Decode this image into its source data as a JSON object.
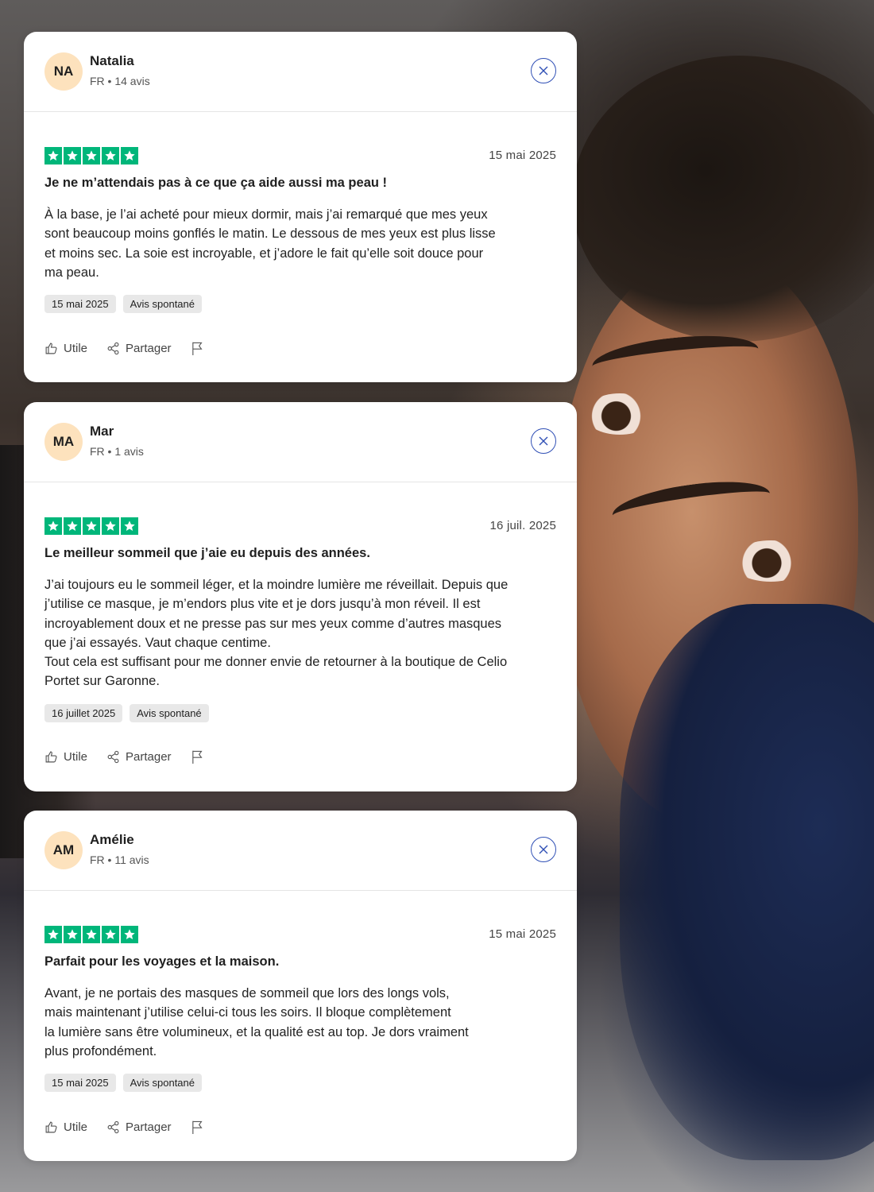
{
  "colors": {
    "star_green": "#00b67a",
    "avatar_bg": "#fde2bd",
    "close_blue": "#2f4fb5"
  },
  "reviews": [
    {
      "avatar_initials": "NA",
      "name": "Natalia",
      "meta": "FR • 14 avis",
      "rating": 5,
      "date": "15 mai 2025",
      "title": "Je ne m’attendais pas à ce que ça aide aussi ma peau !",
      "text": "À la base, je l’ai acheté pour mieux dormir, mais j’ai remarqué que mes yeux\nsont beaucoup moins gonflés le matin. Le dessous de mes yeux est plus lisse\net moins sec. La soie est incroyable, et j’adore le fait qu’elle soit douce pour\nma peau.",
      "tag_date": "15 mai 2025",
      "tag_type": "Avis spontané",
      "useful_label": "Utile",
      "share_label": "Partager"
    },
    {
      "avatar_initials": "MA",
      "name": "Mar",
      "meta": "FR • 1 avis",
      "rating": 5,
      "date": "16 juil. 2025",
      "title": "Le meilleur sommeil que j’aie eu depuis des années.",
      "text": "J’ai toujours eu le sommeil léger, et la moindre lumière me réveillait. Depuis que\nj’utilise ce masque, je m’endors plus vite et je dors jusqu’à mon réveil. Il est\nincroyablement doux et ne presse pas sur mes yeux comme d’autres masques\nque j’ai essayés. Vaut chaque centime.\nTout cela est suffisant pour me donner envie de retourner à la boutique de Celio\nPortet sur Garonne.",
      "tag_date": "16 juillet 2025",
      "tag_type": "Avis spontané",
      "useful_label": "Utile",
      "share_label": "Partager"
    },
    {
      "avatar_initials": "AM",
      "name": "Amélie",
      "meta": "FR • 11 avis",
      "rating": 5,
      "date": "15 mai 2025",
      "title": "Parfait pour les voyages et la maison.",
      "text": "Avant, je ne portais des masques de sommeil que lors des longs vols,\nmais maintenant j’utilise celui-ci tous les soirs. Il bloque complètement\nla lumière sans être volumineux, et la qualité est au top. Je dors vraiment\nplus profondément.",
      "tag_date": "15 mai 2025",
      "tag_type": "Avis spontané",
      "useful_label": "Utile",
      "share_label": "Partager"
    }
  ]
}
